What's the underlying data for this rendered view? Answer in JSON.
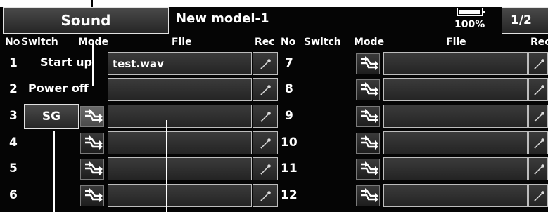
{
  "header": {
    "title": "Sound",
    "model": "New model-1",
    "battery_pct": "100%",
    "battery_level": 1.0,
    "page": "1/2"
  },
  "columns_left": {
    "no": "No",
    "switch": "Switch",
    "mode": "Mode",
    "file": "File",
    "rec": "Rec"
  },
  "columns_right": {
    "no": "No",
    "switch": "Switch",
    "mode": "Mode",
    "file": "File",
    "rec": "Rec"
  },
  "left_rows": [
    {
      "no": "1",
      "switch": "Start up",
      "file": "test.wav"
    },
    {
      "no": "2",
      "switch": "Power off",
      "file": ""
    },
    {
      "no": "3",
      "switch": "SG",
      "file": ""
    },
    {
      "no": "4",
      "switch": "",
      "file": ""
    },
    {
      "no": "5",
      "switch": "",
      "file": ""
    },
    {
      "no": "6",
      "switch": "",
      "file": ""
    }
  ],
  "right_rows": [
    {
      "no": "7",
      "file": ""
    },
    {
      "no": "8",
      "file": ""
    },
    {
      "no": "9",
      "file": ""
    },
    {
      "no": "10",
      "file": ""
    },
    {
      "no": "11",
      "file": ""
    },
    {
      "no": "12",
      "file": ""
    }
  ],
  "icons": {
    "mode": "mode-arrows-icon",
    "rec": "microphone-icon",
    "battery": "battery-icon"
  },
  "colors": {
    "screen_bg": "#050505",
    "accent": "#ffffff"
  }
}
